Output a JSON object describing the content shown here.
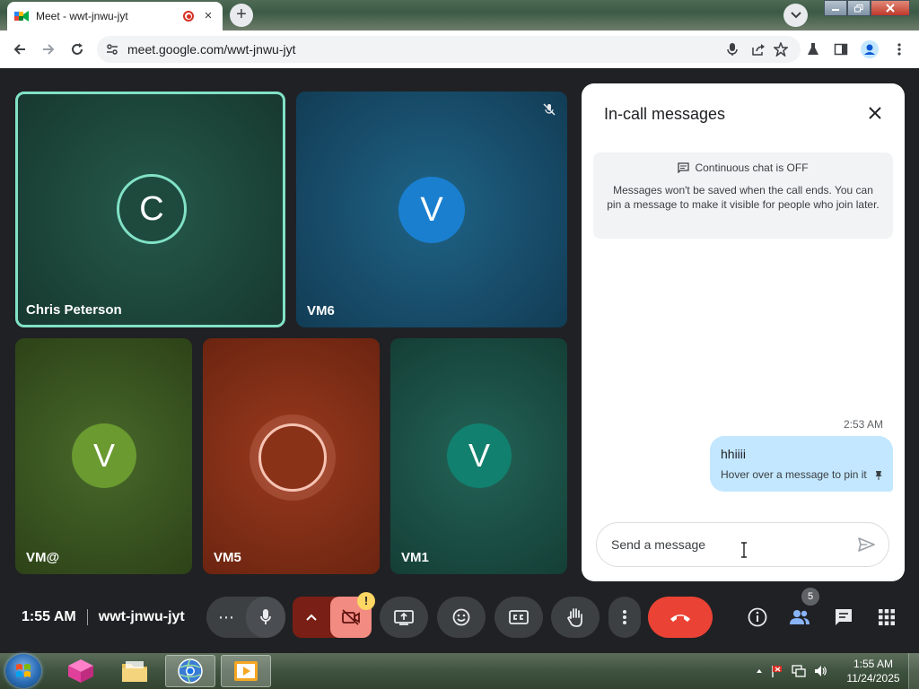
{
  "browser": {
    "tab_title": "Meet - wwt-jnwu-jyt",
    "tab_close": "×",
    "new_tab": "+",
    "url": "meet.google.com/wwt-jnwu-jyt"
  },
  "tiles": [
    {
      "label": "Chris Peterson",
      "initial": "C",
      "color": "#1e4a3e"
    },
    {
      "label": "VM6",
      "initial": "V",
      "color": "#1a4f6e"
    },
    {
      "label": "VM@",
      "initial": "V",
      "color": "#3d5a1f"
    },
    {
      "label": "VM5",
      "initial": "",
      "color": "#8a2e16"
    },
    {
      "label": "VM1",
      "initial": "V",
      "color": "#1b5148"
    }
  ],
  "chat": {
    "title": "In-call messages",
    "notice_title": "Continuous chat is OFF",
    "notice_body": "Messages won't be saved when the call ends. You can pin a message to make it visible for people who join later.",
    "message_time": "2:53 AM",
    "message_text": "hhiiii",
    "message_hint": "Hover over a message to pin it",
    "composer_placeholder": "Send a message"
  },
  "controls": {
    "time": "1:55 AM",
    "meeting_code": "wwt-jnwu-jyt",
    "more_label": "⋯",
    "camera_warning": "!",
    "people_count": "5"
  },
  "taskbar": {
    "clock_time": "1:55 AM",
    "clock_date": "11/24/2025"
  },
  "colors": {
    "end_call": "#ea4335",
    "camera_off": "#f28b82",
    "chat_bubble": "#c2e7ff",
    "speaker_outline": "#81e2c5"
  }
}
